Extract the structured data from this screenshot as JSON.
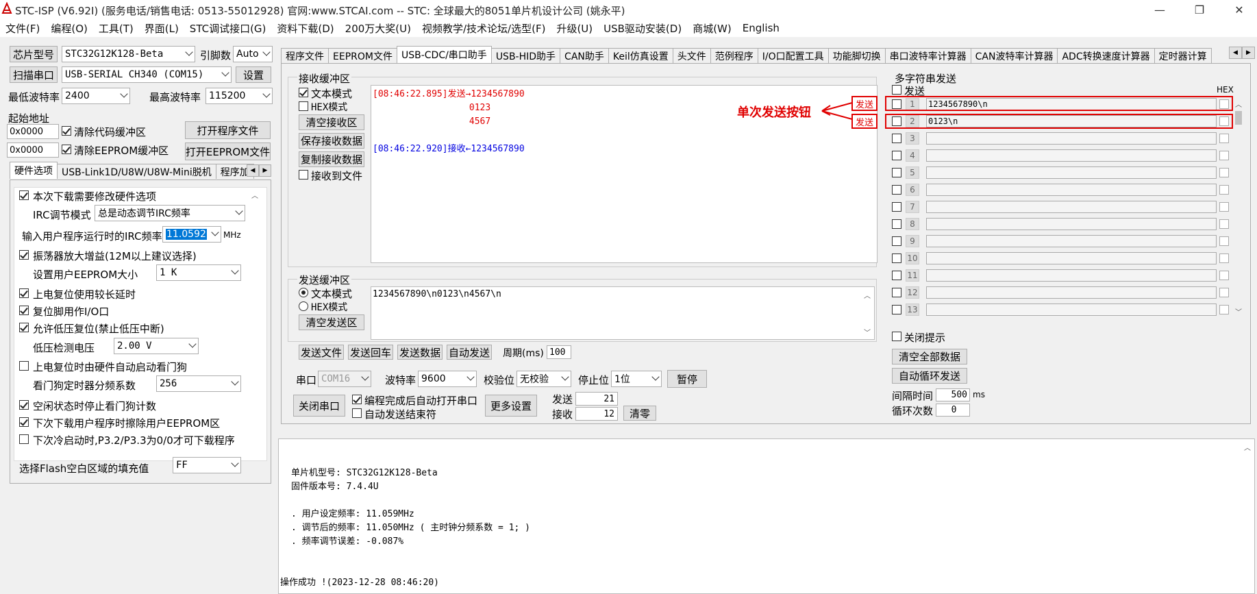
{
  "window": {
    "title": "STC-ISP (V6.92I) (服务电话/销售电话: 0513-55012928) 官网:www.STCAI.com  -- STC: 全球最大的8051单片机设计公司 (姚永平)",
    "minimize": "—",
    "restore": "❐",
    "close": "✕"
  },
  "menu": [
    "文件(F)",
    "编程(O)",
    "工具(T)",
    "界面(L)",
    "STC调试接口(G)",
    "资料下载(D)",
    "200万大奖(U)",
    "视频教学/技术论坛/选型(F)",
    "升级(U)",
    "USB驱动安装(D)",
    "商城(W)",
    "English"
  ],
  "left": {
    "chip_label": "芯片型号",
    "chip_value": "STC32G12K128-Beta",
    "pins_label": "引脚数",
    "pins_value": "Auto",
    "scan_port_button": "扫描串口",
    "port_value": "USB-SERIAL CH340 (COM15)",
    "settings_button": "设置",
    "min_baud_label": "最低波特率",
    "min_baud_value": "2400",
    "max_baud_label": "最高波特率",
    "max_baud_value": "115200",
    "start_addr_label": "起始地址",
    "addr1": "0x0000",
    "clear_code_buffer": "清除代码缓冲区",
    "open_program_button": "打开程序文件",
    "addr2": "0x0000",
    "clear_eeprom_buffer": "清除EEPROM缓冲区",
    "open_eeprom_button": "打开EEPROM文件",
    "tabs": [
      "硬件选项",
      "USB-Link1D/U8W/U8W-Mini脱机",
      "程序加"
    ],
    "hw": {
      "modify_hw_options": "本次下载需要修改硬件选项",
      "irc_mode_label": "IRC调节模式",
      "irc_mode_value": "总是动态调节IRC频率",
      "irc_freq_label": "输入用户程序运行时的IRC频率",
      "irc_freq_value": "11.0592",
      "irc_freq_unit": "MHz",
      "osc_gain": "振荡器放大增益(12M以上建议选择)",
      "eeprom_size_label": "设置用户EEPROM大小",
      "eeprom_size_value": "1   K",
      "power_reset_delay": "上电复位使用较长延时",
      "reset_pin_io": "复位脚用作I/O口",
      "lvd_reset": "允许低压复位(禁止低压中断)",
      "lvd_voltage_label": "低压检测电压",
      "lvd_voltage_value": "2.00 V",
      "wdt_auto": "上电复位时由硬件自动启动看门狗",
      "wdt_div_label": "看门狗定时器分频系数",
      "wdt_div_value": "256",
      "idle_stop_wdt": "空闲状态时停止看门狗计数",
      "erase_eeprom": "下次下载用户程序时擦除用户EEPROM区",
      "cold_boot_p32": "下次冷启动时,P3.2/P3.3为0/0才可下载程序",
      "flash_fill_label": "选择Flash空白区域的填充值",
      "flash_fill_value": "FF"
    }
  },
  "main_tabs": [
    "程序文件",
    "EEPROM文件",
    "USB-CDC/串口助手",
    "USB-HID助手",
    "CAN助手",
    "Keil仿真设置",
    "头文件",
    "范例程序",
    "I/O口配置工具",
    "功能脚切换",
    "串口波特率计算器",
    "CAN波特率计算器",
    "ADC转换速度计算器",
    "定时器计算"
  ],
  "recv": {
    "title": "接收缓冲区",
    "text_mode": "文本模式",
    "hex_mode": "HEX模式",
    "clear_button": "清空接收区",
    "save_button": "保存接收数据",
    "copy_button": "复制接收数据",
    "recv_to_file": "接收到文件",
    "lines": [
      {
        "text": "[08:46:22.895]发送→1234567890",
        "color": "#e00000"
      },
      {
        "text": "                  0123",
        "color": "#e00000"
      },
      {
        "text": "                  4567",
        "color": "#e00000"
      },
      {
        "text": "",
        "color": "#000"
      },
      {
        "text": "[08:46:22.920]接收←1234567890",
        "color": "#0000e0"
      }
    ]
  },
  "annotation": {
    "text": "单次发送按钮",
    "send1": "发送",
    "send2": "发送"
  },
  "send": {
    "title": "发送缓冲区",
    "text_mode": "文本模式",
    "hex_mode": "HEX模式",
    "clear_button": "清空发送区",
    "content": "1234567890\\n0123\\n4567\\n",
    "send_file_button": "发送文件",
    "send_return_button": "发送回车",
    "send_data_button": "发送数据",
    "auto_send_button": "自动发送",
    "period_label": "周期(ms)",
    "period_value": "100"
  },
  "serial": {
    "port_label": "串口",
    "port_value": "COM16",
    "baud_label": "波特率",
    "baud_value": "9600",
    "parity_label": "校验位",
    "parity_value": "无校验",
    "stop_label": "停止位",
    "stop_value": "1位",
    "pause_button": "暂停",
    "close_port_button": "关闭串口",
    "auto_open_after_compile": "编程完成后自动打开串口",
    "auto_send_end": "自动发送结束符",
    "more_settings_button": "更多设置",
    "sent_label": "发送",
    "sent_value": "21",
    "recv_label": "接收",
    "recv_value": "12",
    "clear_count_button": "清零"
  },
  "multi": {
    "title": "多字符串发送",
    "send_col": "发送",
    "hex_col": "HEX",
    "rows": [
      {
        "n": "1",
        "v": "1234567890\\n"
      },
      {
        "n": "2",
        "v": "0123\\n"
      },
      {
        "n": "3",
        "v": ""
      },
      {
        "n": "4",
        "v": ""
      },
      {
        "n": "5",
        "v": ""
      },
      {
        "n": "6",
        "v": ""
      },
      {
        "n": "7",
        "v": ""
      },
      {
        "n": "8",
        "v": ""
      },
      {
        "n": "9",
        "v": ""
      },
      {
        "n": "10",
        "v": ""
      },
      {
        "n": "11",
        "v": ""
      },
      {
        "n": "12",
        "v": ""
      },
      {
        "n": "13",
        "v": ""
      }
    ],
    "close_hint": "关闭提示",
    "clear_all_button": "清空全部数据",
    "auto_loop_button": "自动循环发送",
    "interval_label": "间隔时间",
    "interval_value": "500",
    "interval_unit": "ms",
    "loop_label": "循环次数",
    "loop_value": "0"
  },
  "output": {
    "lines": [
      "",
      "单片机型号: STC32G12K128-Beta",
      "固件版本号: 7.4.4U",
      "",
      ". 用户设定频率: 11.059MHz",
      ". 调节后的频率: 11.050MHz ( 主时钟分频系数 = 1; )",
      ". 频率调节误差: -0.087%",
      "",
      "",
      "操作成功 !(2023-12-28 08:46:20)"
    ]
  }
}
